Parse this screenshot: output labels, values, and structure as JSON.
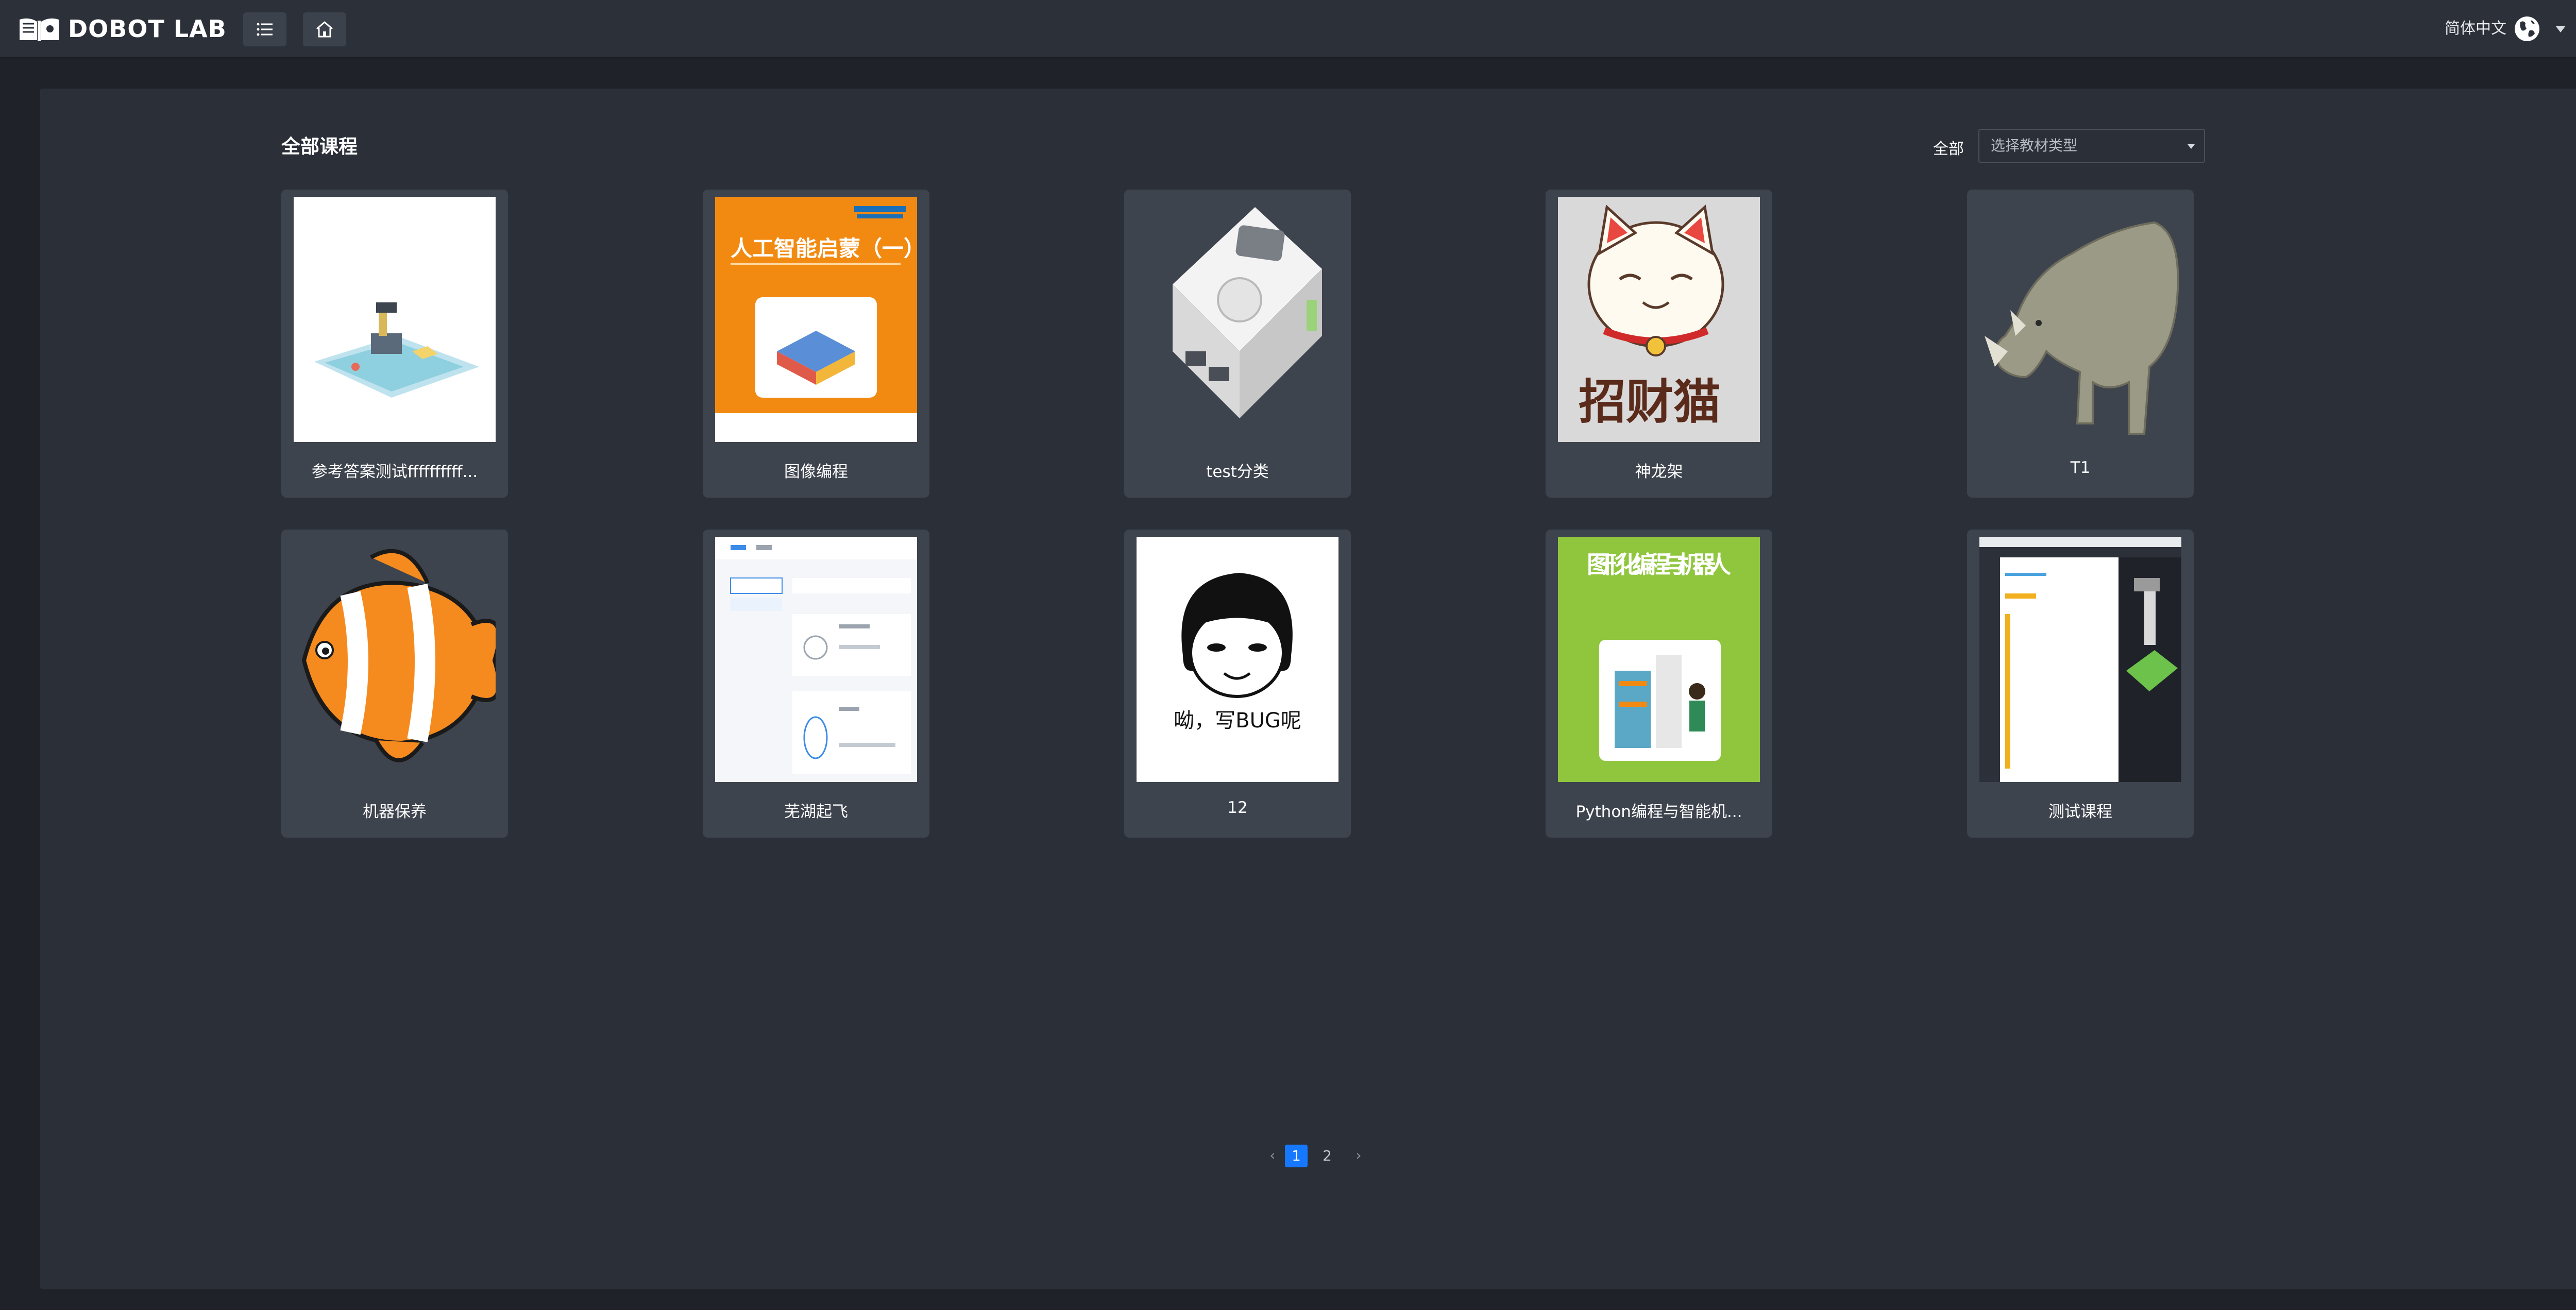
{
  "app": {
    "logo_text": "DOBOT LAB"
  },
  "header": {
    "menu_icon": "list-icon",
    "home_icon": "home-icon",
    "language": "简体中文",
    "globe_icon": "globe-icon"
  },
  "main": {
    "title": "全部课程",
    "filter": {
      "label": "全部",
      "placeholder": "选择教材类型"
    },
    "courses": [
      {
        "title": "参考答案测试ffffffffff...",
        "thumb": "robot-arm-mat"
      },
      {
        "title": "图像编程",
        "thumb": "ai-book-cover",
        "cover_text": "人工智能启蒙（一）"
      },
      {
        "title": "test分类",
        "thumb": "white-device"
      },
      {
        "title": "神龙架",
        "thumb": "lucky-cat",
        "cover_text": "招财猫"
      },
      {
        "title": "T1",
        "thumb": "rhino"
      },
      {
        "title": "机器保养",
        "thumb": "clownfish"
      },
      {
        "title": "芜湖起飞",
        "thumb": "ui-screenshot"
      },
      {
        "title": "12",
        "thumb": "meme-face",
        "cover_text": "呦，写BUG呢"
      },
      {
        "title": "Python编程与智能机...",
        "thumb": "green-book-cover",
        "cover_text": "图形化编程与机器人"
      },
      {
        "title": "测试课程",
        "thumb": "software-screenshot"
      }
    ]
  },
  "pagination": {
    "prev_icon": "chevron-left-icon",
    "next_icon": "chevron-right-icon",
    "pages": [
      "1",
      "2"
    ],
    "current": "1"
  },
  "colors": {
    "topbar": "#2b3039",
    "panel": "#2b3038",
    "card": "#3e444e",
    "accent": "#1677ff"
  }
}
